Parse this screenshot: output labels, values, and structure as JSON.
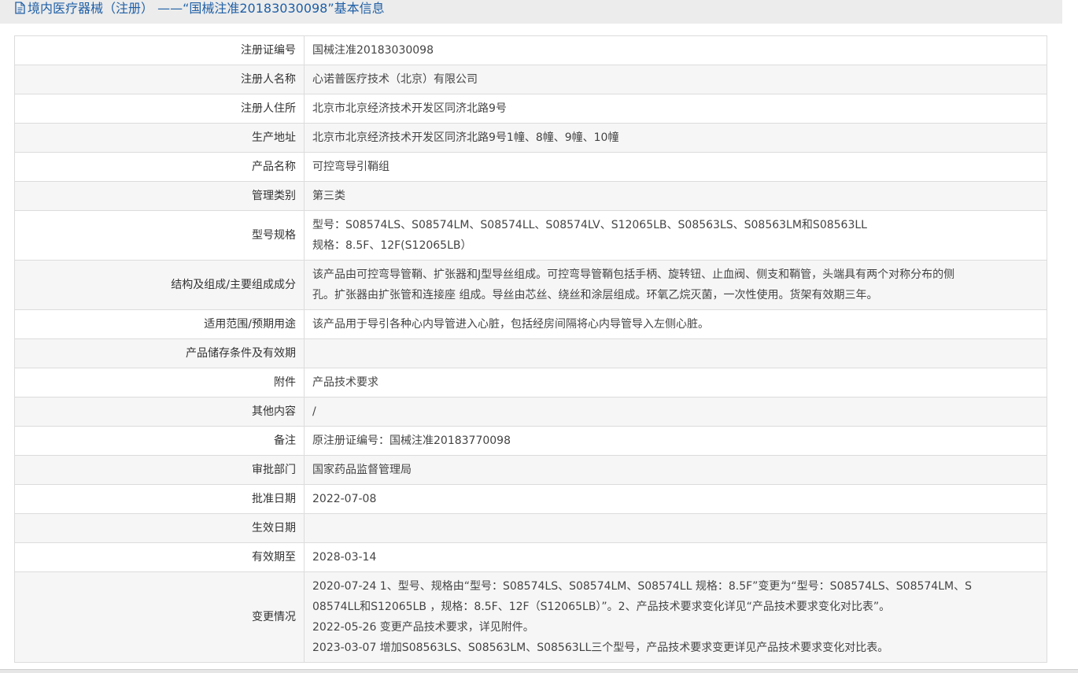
{
  "header": {
    "title": "境内医疗器械（注册） ——“国械注准20183030098”基本信息",
    "icon": "document-icon"
  },
  "rows": [
    {
      "label": "注册证编号",
      "value": "国械注准20183030098"
    },
    {
      "label": "注册人名称",
      "value": "心诺普医疗技术（北京）有限公司"
    },
    {
      "label": "注册人住所",
      "value": "北京市北京经济技术开发区同济北路9号"
    },
    {
      "label": "生产地址",
      "value": "北京市北京经济技术开发区同济北路9号1幢、8幢、9幢、10幢"
    },
    {
      "label": "产品名称",
      "value": "可控弯导引鞘组"
    },
    {
      "label": "管理类别",
      "value": "第三类"
    },
    {
      "label": "型号规格",
      "lines": [
        "型号：S08574LS、S08574LM、S08574LL、S08574LV、S12065LB、S08563LS、S08563LM和S08563LL",
        "规格：8.5F、12F(S12065LB）"
      ]
    },
    {
      "label": "结构及组成/主要组成成分",
      "lines": [
        "该产品由可控弯导管鞘、扩张器和J型导丝组成。可控弯导管鞘包括手柄、旋转钮、止血阀、侧支和鞘管，头端具有两个对称分布的侧",
        "孔。扩张器由扩张管和连接座 组成。导丝由芯丝、绕丝和涂层组成。环氧乙烷灭菌，一次性使用。货架有效期三年。"
      ]
    },
    {
      "label": "适用范围/预期用途",
      "value": "该产品用于导引各种心内导管进入心脏，包括经房间隔将心内导管导入左侧心脏。"
    },
    {
      "label": "产品储存条件及有效期",
      "value": ""
    },
    {
      "label": "附件",
      "value": "产品技术要求"
    },
    {
      "label": "其他内容",
      "value": "/"
    },
    {
      "label": "备注",
      "value": "原注册证编号：国械注准20183770098"
    },
    {
      "label": "审批部门",
      "value": "国家药品监督管理局"
    },
    {
      "label": "批准日期",
      "value": "2022-07-08"
    },
    {
      "label": "生效日期",
      "value": ""
    },
    {
      "label": "有效期至",
      "value": "2028-03-14"
    },
    {
      "label": "变更情况",
      "lines": [
        "2020-07-24 1、型号、规格由“型号：S08574LS、S08574LM、S08574LL 规格：8.5F”变更为“型号：S08574LS、S08574LM、S",
        "08574LL和S12065LB ，规格：8.5F、12F（S12065LB）”。2、产品技术要求变化详见“产品技术要求变化对比表”。",
        "2022-05-26 变更产品技术要求，详见附件。",
        "2023-03-07 增加S08563LS、S08563LM、S08563LL三个型号，产品技术要求变更详见产品技术要求变化对比表。"
      ]
    }
  ]
}
